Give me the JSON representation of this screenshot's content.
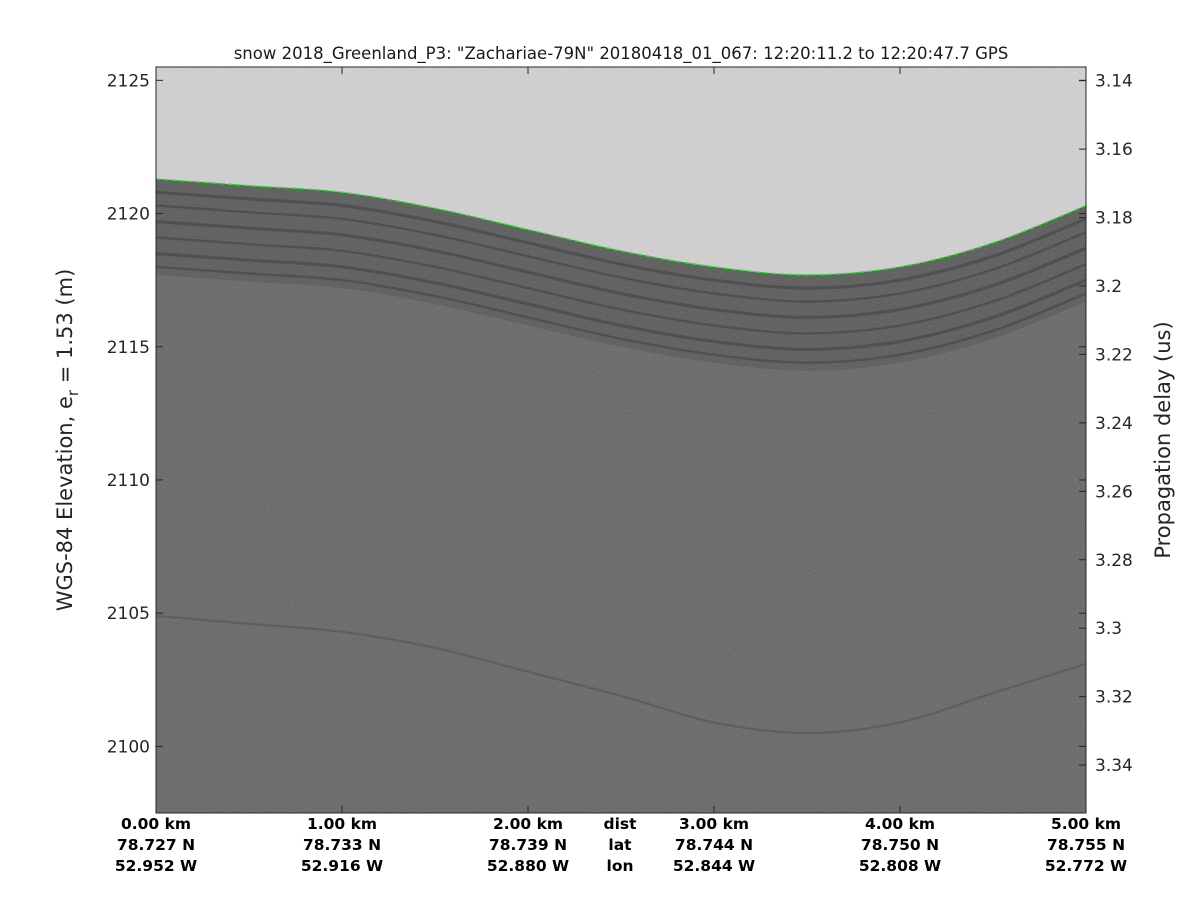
{
  "chart_data": {
    "type": "heatmap",
    "title": "snow 2018_Greenland_P3: \"Zachariae-79N\"  20180418_01_067: 12:20:11.2 to 12:20:47.7 GPS",
    "ylabel": "WGS-84 Elevation, e",
    "ylabel_subscript": "r",
    "ylabel_suffix": " = 1.53 (m)",
    "y2label": "Propagation delay (us)",
    "xlim_km": [
      0,
      5
    ],
    "ylim": [
      2097.5,
      2125.5
    ],
    "y2lim": [
      3.136,
      3.354
    ],
    "y_ticks": [
      2100,
      2105,
      2110,
      2115,
      2120,
      2125
    ],
    "y2_ticks": [
      3.14,
      3.16,
      3.18,
      3.2,
      3.22,
      3.24,
      3.26,
      3.28,
      3.3,
      3.32,
      3.34
    ],
    "y_tick_labels": [
      "2100",
      "2105",
      "2110",
      "2115",
      "2120",
      "2125"
    ],
    "y2_tick_labels": [
      "3.14",
      "3.16",
      "3.18",
      "3.2",
      "3.22",
      "3.24",
      "3.26",
      "3.28",
      "3.3",
      "3.32",
      "3.34"
    ],
    "x_ticks_km": [
      0,
      1,
      2,
      3,
      4,
      5
    ],
    "bottom_labels": {
      "dist": [
        "0.00 km",
        "1.00 km",
        "2.00 km",
        "3.00 km",
        "4.00 km",
        "5.00 km"
      ],
      "lat": [
        "78.727 N",
        "78.733 N",
        "78.739 N",
        "78.744 N",
        "78.750 N",
        "78.755 N"
      ],
      "lon": [
        "52.952 W",
        "52.916 W",
        "52.880 W",
        "52.844 W",
        "52.808 W",
        "52.772 W"
      ],
      "row_names": [
        "dist",
        "lat",
        "lon"
      ],
      "row_name_x_km": 2.5
    },
    "surface_elevation": {
      "x_km": [
        0,
        0.5,
        1.0,
        1.5,
        2.0,
        2.5,
        3.0,
        3.5,
        4.0,
        4.5,
        5.0
      ],
      "y": [
        2121.3,
        2121.05,
        2120.8,
        2120.2,
        2119.4,
        2118.6,
        2118.0,
        2117.7,
        2118.0,
        2118.9,
        2120.3
      ]
    },
    "near_surface_layer_offsets_m": [
      0.5,
      1.0,
      1.6,
      2.2,
      2.8,
      3.3
    ],
    "deep_reflector": {
      "x_km": [
        0,
        0.5,
        1.0,
        1.5,
        2.0,
        2.5,
        3.0,
        3.5,
        4.0,
        4.5,
        5.0
      ],
      "y": [
        2104.9,
        2104.6,
        2104.3,
        2103.7,
        2102.8,
        2101.9,
        2100.9,
        2100.5,
        2100.9,
        2102.0,
        2103.1
      ]
    },
    "colors": {
      "air": "#d6d6d6",
      "snow_top": "#6a6a6a",
      "snow_deep": "#595959",
      "layer": "#3a3a3a",
      "surface_pick": "#22ee22",
      "axis": "#262626"
    }
  }
}
